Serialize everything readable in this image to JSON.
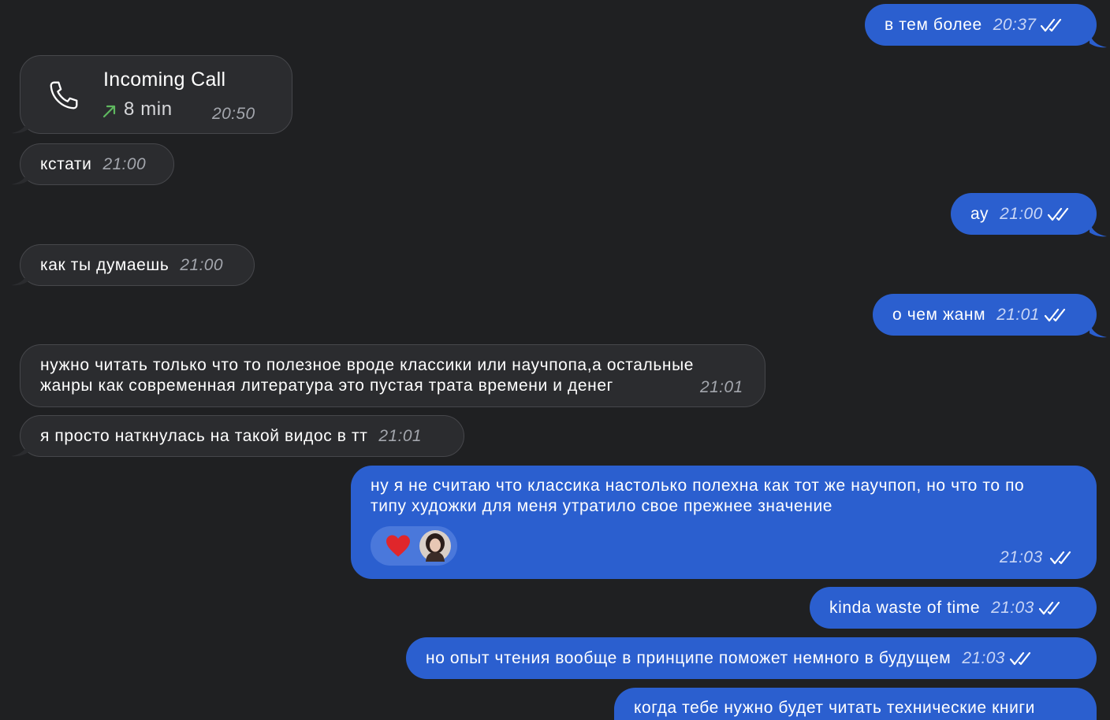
{
  "messages": [
    {
      "text": "в тем более",
      "time": "20:37"
    },
    {
      "title": "Incoming Call",
      "duration": "8 min",
      "time": "20:50"
    },
    {
      "text": "кстати",
      "time": "21:00"
    },
    {
      "text": "ау",
      "time": "21:00"
    },
    {
      "text": "как ты думаешь",
      "time": "21:00"
    },
    {
      "text": "о чем жанм",
      "time": "21:01"
    },
    {
      "line1": "нужно читать только что то полезное вроде классики или научпопа,а остальные",
      "line2": "жанры как современная литература это пустая трата времени и денег",
      "time": "21:01"
    },
    {
      "text": "я просто наткнулась на такой видос в тт",
      "time": "21:01"
    },
    {
      "line1": "ну я не считаю что классика настолько полехна как тот же научпоп, но что то по",
      "line2": "типу художки для меня утратило свое прежнее значение",
      "time": "21:03",
      "reaction": "heart-reaction"
    },
    {
      "text": "kinda waste of time",
      "time": "21:03"
    },
    {
      "text": "но опыт чтения вообще в принципе поможет немного в будущем",
      "time": "21:03"
    },
    {
      "text": "когда тебе нужно будет читать технические книги"
    }
  ],
  "colors": {
    "background": "#1f2022",
    "incoming_bubble": "#2b2c2f",
    "outgoing_bubble": "#2b5fcf",
    "call_arrow": "#5fb85f",
    "reaction_heart": "#e0262b"
  }
}
